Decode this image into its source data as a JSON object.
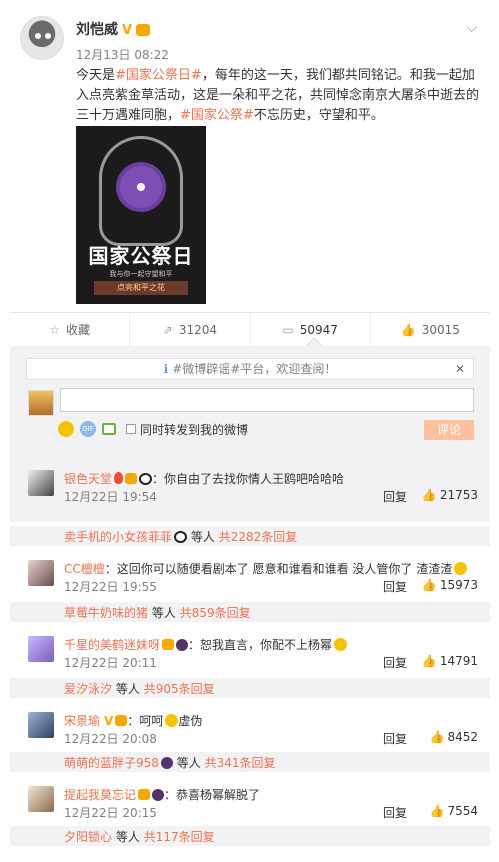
{
  "post": {
    "author": "刘恺威",
    "verified": "V",
    "time": "12月13日 08:22",
    "text_prefix": "今天是",
    "tag1": "#国家公祭日#",
    "text_mid": "，每年的这一天，我们都共同铭记。和我一起加入点亮紫金草活动，这是一朵和平之花，共同悼念南京大屠杀中逝去的三十万遇难同胞，",
    "tag2": "#国家公祭#",
    "text_end": "不忘历史，守望和平。",
    "poster": {
      "title": "国家公祭日",
      "sub": "我与你一起守望和平",
      "line": "点亮和平之花"
    }
  },
  "actions": {
    "favorite": "收藏",
    "repost": "31204",
    "comment": "50947",
    "like": "30015"
  },
  "comment_box": {
    "notice": "#微博辟谣#平台，欢迎查阅！",
    "also_repost": "同时转发到我的微博",
    "submit": "评论"
  },
  "comments": [
    {
      "name": "银色天堂",
      "text": "：你自由了去找你情人王鸥吧哈哈哈",
      "time": "12月22日 19:54",
      "reply": "回复",
      "likes": "21753",
      "sub_name": "卖手机的小女孩菲菲",
      "sub_mid": "等人",
      "sub_count": "共2282条回复"
    },
    {
      "name": "CC檀檀",
      "text": "：这回你可以随便看剧本了  愿意和谁看和谁看 没人管你了 渣渣渣",
      "time": "12月22日 19:55",
      "reply": "回复",
      "likes": "15973",
      "sub_name": "草莓牛奶味的猪",
      "sub_mid": "等人",
      "sub_count": "共859条回复"
    },
    {
      "name": "千星的美鹤迷妹呀",
      "text": "：恕我直言，你配不上杨幂",
      "time": "12月22日 20:11",
      "reply": "回复",
      "likes": "14791",
      "sub_name": "爱汐泳汐",
      "sub_mid": "等人",
      "sub_count": "共905条回复"
    },
    {
      "name": "宋景瑜",
      "text": "：呵呵",
      "text2": "虚伪",
      "time": "12月22日 20:08",
      "reply": "回复",
      "likes": "8452",
      "sub_name": "萌萌的蓝胖子958",
      "sub_mid": "等人",
      "sub_count": "共341条回复"
    },
    {
      "name": "提起我莫忘记",
      "text": "：恭喜杨幂解脱了",
      "time": "12月22日 20:15",
      "reply": "回复",
      "likes": "7554",
      "sub_name": "夕阳锁心",
      "sub_mid": "等人",
      "sub_count": "共117条回复"
    }
  ]
}
